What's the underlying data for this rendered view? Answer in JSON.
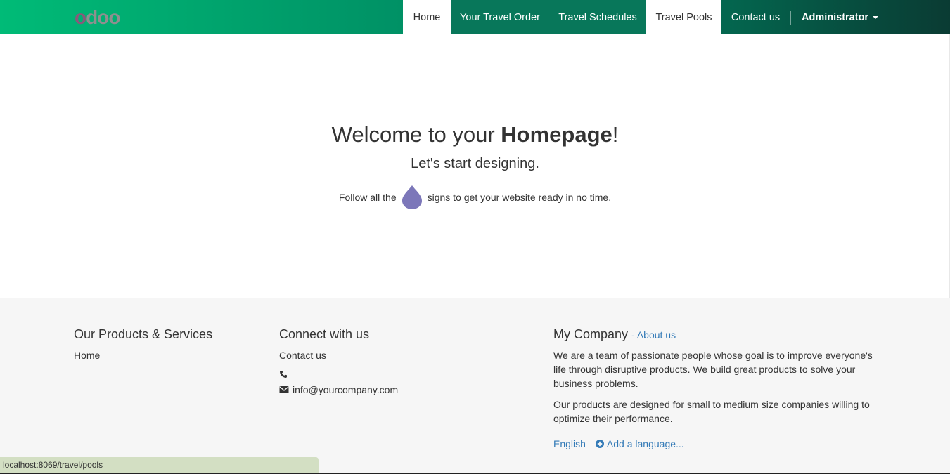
{
  "brand": {
    "logo_first": "o",
    "logo_rest": "doo"
  },
  "nav": {
    "items": [
      {
        "label": "Home"
      },
      {
        "label": "Your Travel Order"
      },
      {
        "label": "Travel Schedules"
      },
      {
        "label": "Travel Pools"
      },
      {
        "label": "Contact us"
      }
    ],
    "user": "Administrator"
  },
  "hero": {
    "title_pre": "Welcome to your ",
    "title_bold": "Homepage",
    "title_post": "!",
    "subtitle": "Let's start designing.",
    "follow_pre": "Follow all the",
    "follow_post": "signs to get your website ready in no time."
  },
  "footer": {
    "products": {
      "heading": "Our Products & Services",
      "links": [
        "Home"
      ]
    },
    "connect": {
      "heading": "Connect with us",
      "link": "Contact us",
      "phone": "",
      "email": "info@yourcompany.com"
    },
    "company": {
      "heading": "My Company",
      "about_link": "- About us",
      "para1": "We are a team of passionate people whose goal is to improve everyone's life through disruptive products. We build great products to solve your business problems.",
      "para2": "Our products are designed for small to medium size companies willing to optimize their performance.",
      "language": "English",
      "add_language": "Add a language..."
    }
  },
  "status_bar": {
    "url": "localhost:8069/travel/pools"
  },
  "colors": {
    "link": "#337ab7",
    "drop": "#7c77b9",
    "brand_purple": "#875a7b"
  }
}
